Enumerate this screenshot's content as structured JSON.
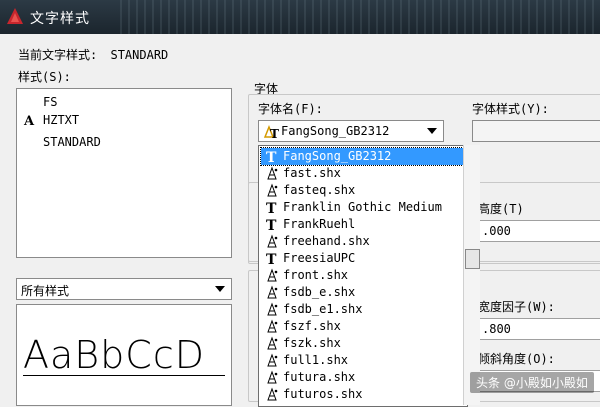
{
  "window": {
    "title": "文字样式"
  },
  "current_style": {
    "label": "当前文字样式:",
    "value": "STANDARD"
  },
  "styles": {
    "label": "样式(S):",
    "items": [
      "FS",
      "HZTXT",
      "STANDARD"
    ]
  },
  "filter": {
    "value": "所有样式"
  },
  "preview": {
    "text": "AaBbCcD"
  },
  "font": {
    "group_label": "字体",
    "name_label": "字体名(F):",
    "name_value": "FangSong_GB2312",
    "style_label": "字体样式(Y):",
    "options": [
      {
        "text": "FangSong_GB2312",
        "icon": "truetype-font-icon"
      },
      {
        "text": "fast.shx",
        "icon": "shx-font-icon"
      },
      {
        "text": "fasteq.shx",
        "icon": "shx-font-icon"
      },
      {
        "text": "Franklin Gothic Medium",
        "icon": "truetype-font-icon"
      },
      {
        "text": "FrankRuehl",
        "icon": "truetype-font-icon"
      },
      {
        "text": "freehand.shx",
        "icon": "shx-font-icon"
      },
      {
        "text": "FreesiaUPC",
        "icon": "truetype-font-icon"
      },
      {
        "text": "front.shx",
        "icon": "shx-font-icon"
      },
      {
        "text": "fsdb_e.shx",
        "icon": "shx-font-icon"
      },
      {
        "text": "fsdb_e1.shx",
        "icon": "shx-font-icon"
      },
      {
        "text": "fszf.shx",
        "icon": "shx-font-icon"
      },
      {
        "text": "fszk.shx",
        "icon": "shx-font-icon"
      },
      {
        "text": "full1.shx",
        "icon": "shx-font-icon"
      },
      {
        "text": "futura.shx",
        "icon": "shx-font-icon"
      },
      {
        "text": "futuros.shx",
        "icon": "shx-font-icon"
      }
    ]
  },
  "size": {
    "height_label": "高度(T)",
    "height_value": ".000"
  },
  "effects": {
    "width_label": "宽度因子(W):",
    "width_value": ".800",
    "oblique_label": "倾斜角度(O):"
  },
  "watermark": {
    "text": "头条 @小殿如小殿如"
  },
  "colors": {
    "accent": "#3399ff",
    "titlebar": "#1b252d"
  }
}
